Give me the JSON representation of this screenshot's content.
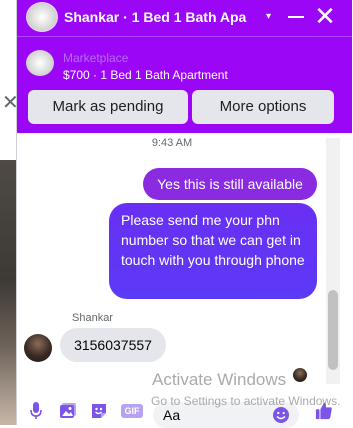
{
  "header": {
    "title": "Shankar · 1 Bed 1 Bath Apa",
    "chevron_icon": "chevron-down-icon",
    "minimize_icon": "minimize-icon",
    "close_icon": "close-icon",
    "close_glyph": "✕"
  },
  "listing": {
    "source": "Marketplace",
    "detail": "$700 · 1 Bed 1 Bath Apartment"
  },
  "actions": {
    "mark_pending": "Mark as pending",
    "more_options": "More options"
  },
  "background": {
    "close_glyph": "✕"
  },
  "conversation": {
    "timestamp": "9:43 AM",
    "outgoing": [
      "Yes this is still available",
      "Please send me your phn number so that we can get in touch with you through phone"
    ],
    "incoming_sender": "Shankar",
    "incoming": [
      "3156037557"
    ]
  },
  "composer": {
    "placeholder": "Aa",
    "gif_label": "GIF"
  },
  "watermark": {
    "title": "Activate Windows",
    "subtitle": "Go to Settings to activate Windows."
  },
  "colors": {
    "header_bg": "#9b06f7",
    "outgoing_bubble": "#8a2be2",
    "outgoing_bubble_2": "#5b3af6",
    "incoming_bubble": "#e4e6eb",
    "icon_accent": "#7b55e8"
  }
}
